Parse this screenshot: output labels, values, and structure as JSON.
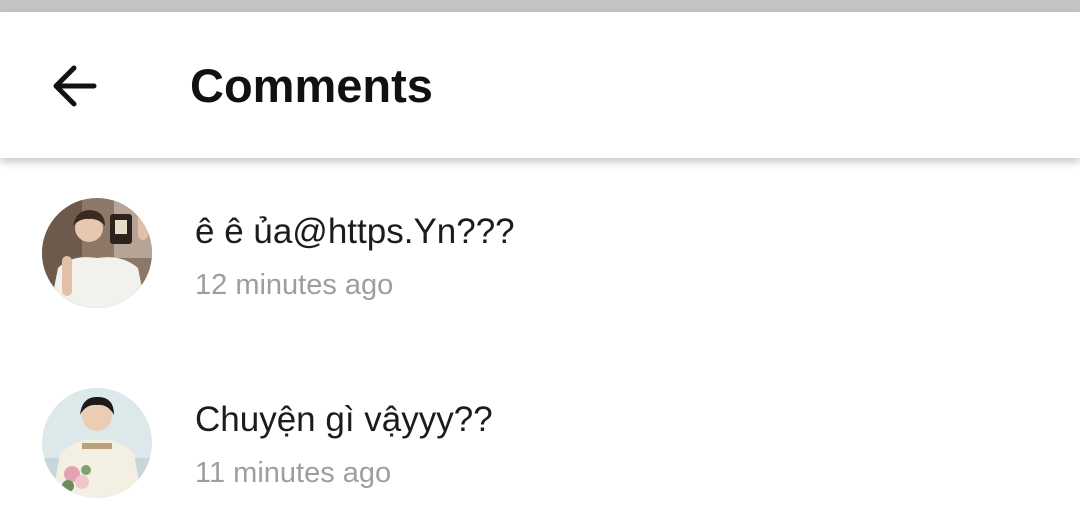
{
  "header": {
    "title": "Comments",
    "back_icon": "arrow-left-icon"
  },
  "comments": [
    {
      "avatar_icon": "user-avatar-photo",
      "text": "ê ê ủa@https.Yn???",
      "time": "12 minutes ago"
    },
    {
      "avatar_icon": "user-avatar-photo",
      "text": "Chuyện gì vậyyy??",
      "time": "11 minutes ago"
    }
  ],
  "colors": {
    "text_primary": "#111111",
    "text_secondary": "#9e9e9e",
    "status_strip": "#c4c4c4"
  }
}
